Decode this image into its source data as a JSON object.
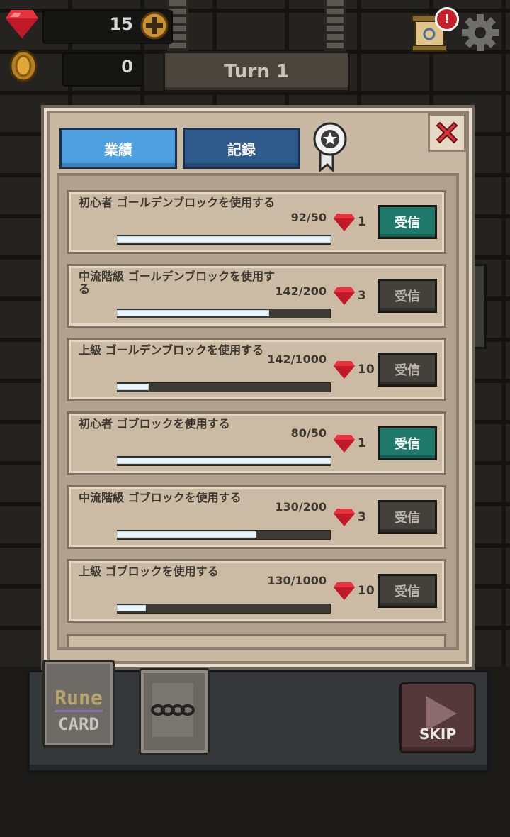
{
  "hud": {
    "gem_count": "15",
    "coin_count": "0",
    "turn_label": "Turn 1",
    "alert_badge": "!"
  },
  "dialog": {
    "tabs": [
      {
        "label": "業績",
        "active": true
      },
      {
        "label": "記録",
        "active": false
      }
    ],
    "achievements": [
      {
        "title": "初心者 ゴールデンブロックを使用する",
        "progress": "92/50",
        "fill": 1.0,
        "reward": "1",
        "claim": "受信",
        "claimable": true
      },
      {
        "title": "中流階級 ゴールデンブロックを使用する",
        "progress": "142/200",
        "fill": 0.71,
        "reward": "3",
        "claim": "受信",
        "claimable": false
      },
      {
        "title": "上級 ゴールデンブロックを使用する",
        "progress": "142/1000",
        "fill": 0.142,
        "reward": "10",
        "claim": "受信",
        "claimable": false
      },
      {
        "title": "初心者 ゴブロックを使用する",
        "progress": "80/50",
        "fill": 1.0,
        "reward": "1",
        "claim": "受信",
        "claimable": true
      },
      {
        "title": "中流階級 ゴブロックを使用する",
        "progress": "130/200",
        "fill": 0.65,
        "reward": "3",
        "claim": "受信",
        "claimable": false
      },
      {
        "title": "上級 ゴブロックを使用する",
        "progress": "130/1000",
        "fill": 0.13,
        "reward": "10",
        "claim": "受信",
        "claimable": false
      }
    ]
  },
  "tray": {
    "rune_card_top": "Rune",
    "rune_card_bottom": "CARD",
    "skip_label": "SKIP"
  },
  "colors": {
    "claim_active": "#1f7a6b",
    "claim_inactive": "#44413c",
    "tab_active": "#4ea0e0",
    "tab_inactive": "#2e5a8c",
    "gem": "#d8202c"
  }
}
